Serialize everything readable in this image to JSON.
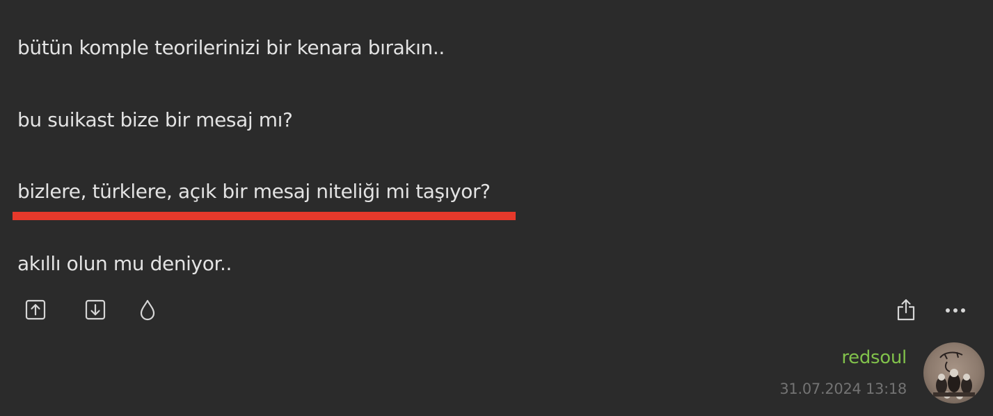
{
  "entry": {
    "paragraphs": [
      "bütün komple teorilerinizi bir kenara bırakın..",
      "bu suikast bize bir mesaj mı?",
      "bizlere, türklere, açık bir mesaj niteliği mi taşıyor?",
      "akıllı olun mu deniyor.."
    ],
    "highlight_color": "#e6392b"
  },
  "actions": {
    "upvote_icon": "upvote-icon",
    "downvote_icon": "downvote-icon",
    "drop_icon": "drop-icon",
    "share_icon": "share-icon",
    "more_icon": "more-icon"
  },
  "footer": {
    "author": "redsoul",
    "timestamp": "31.07.2024 13:18",
    "author_color": "#81c14b"
  }
}
